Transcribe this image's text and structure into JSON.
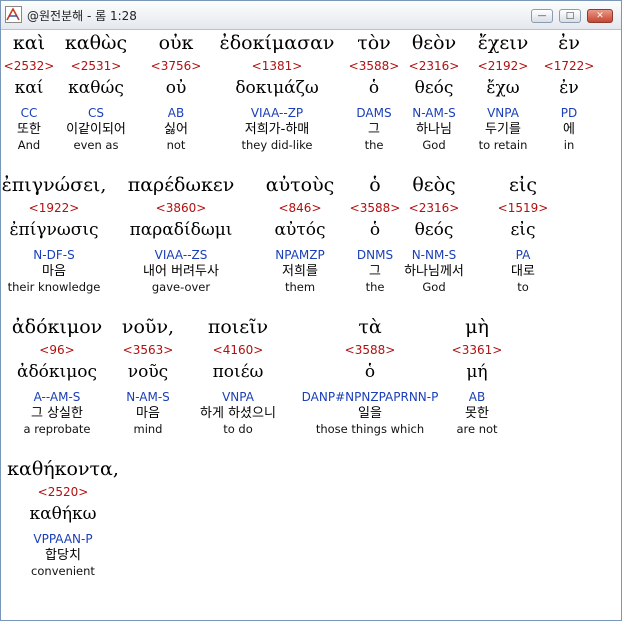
{
  "window": {
    "title": "@원전분해 - 롬 1:28",
    "buttons": {
      "minimize": "—",
      "maximize": "□",
      "close": "✕"
    }
  },
  "rows": [
    {
      "words": [
        {
          "greek": "καὶ",
          "strong": "<2532>",
          "lemma": "καί",
          "parse": "CC",
          "korean": "또한",
          "english": "And"
        },
        {
          "greek": "καθὼς",
          "strong": "<2531>",
          "lemma": "καθώς",
          "parse": "CS",
          "korean": "이같이되어",
          "english": "even as"
        },
        {
          "greek": "οὐκ",
          "strong": "<3756>",
          "lemma": "οὐ",
          "parse": "AB",
          "korean": "싫어",
          "english": "not"
        },
        {
          "greek": "ἐδοκίμασαν",
          "strong": "<1381>",
          "lemma": "δοκιμάζω",
          "parse": "VIAA--ZP",
          "korean": "저희가-하매",
          "english": "they did-like"
        },
        {
          "greek": "τὸν",
          "strong": "<3588>",
          "lemma": "ὁ",
          "parse": "DAMS",
          "korean": "그",
          "english": "the"
        },
        {
          "greek": "θεὸν",
          "strong": "<2316>",
          "lemma": "θεός",
          "parse": "N-AM-S",
          "korean": "하나님",
          "english": "God"
        },
        {
          "greek": "ἔχειν",
          "strong": "<2192>",
          "lemma": "ἔχω",
          "parse": "VNPA",
          "korean": "두기를",
          "english": "to retain"
        },
        {
          "greek": "ἐν",
          "strong": "<1722>",
          "lemma": "ἐν",
          "parse": "PD",
          "korean": "에",
          "english": "in"
        }
      ]
    },
    {
      "words": [
        {
          "greek": "ἐπιγνώσει,",
          "strong": "<1922>",
          "lemma": "ἐπίγνωσις",
          "parse": "N-DF-S",
          "korean": "마음",
          "english": "their knowledge"
        },
        {
          "greek": "παρέδωκεν",
          "strong": "<3860>",
          "lemma": "παραδίδωμι",
          "parse": "VIAA--ZS",
          "korean": "내어 버려두사",
          "english": "gave-over"
        },
        {
          "greek": "αὐτοὺς",
          "strong": "<846>",
          "lemma": "αὐτός",
          "parse": "NPAMZP",
          "korean": "저희를",
          "english": "them"
        },
        {
          "greek": "ὁ",
          "strong": "<3588>",
          "lemma": "ὁ",
          "parse": "DNMS",
          "korean": "그",
          "english": "the"
        },
        {
          "greek": "θεὸς",
          "strong": "<2316>",
          "lemma": "θεός",
          "parse": "N-NM-S",
          "korean": "하나님께서",
          "english": "God"
        },
        {
          "greek": "εἰς",
          "strong": "<1519>",
          "lemma": "εἰς",
          "parse": "PA",
          "korean": "대로",
          "english": "to"
        }
      ]
    },
    {
      "words": [
        {
          "greek": "ἀδόκιμον",
          "strong": "<96>",
          "lemma": "ἀδόκιμος",
          "parse": "A--AM-S",
          "korean": "그 상실한",
          "english": "a reprobate"
        },
        {
          "greek": "νοῦν,",
          "strong": "<3563>",
          "lemma": "νοῦς",
          "parse": "N-AM-S",
          "korean": "마음",
          "english": "mind"
        },
        {
          "greek": "ποιεῖν",
          "strong": "<4160>",
          "lemma": "ποιέω",
          "parse": "VNPA",
          "korean": "하게 하셨으니",
          "english": "to do"
        },
        {
          "greek": "τὰ",
          "strong": "<3588>",
          "lemma": "ὁ",
          "parse": "DANP#NPNZPAPRNN-P",
          "korean": "일을",
          "english": "those things which"
        },
        {
          "greek": "μὴ",
          "strong": "<3361>",
          "lemma": "μή",
          "parse": "AB",
          "korean": "못한",
          "english": "are not"
        }
      ]
    },
    {
      "words": [
        {
          "greek": "καθήκοντα,",
          "strong": "<2520>",
          "lemma": "καθήκω",
          "parse": "VPPAAN-P",
          "korean": "합당치",
          "english": "convenient"
        }
      ]
    }
  ]
}
